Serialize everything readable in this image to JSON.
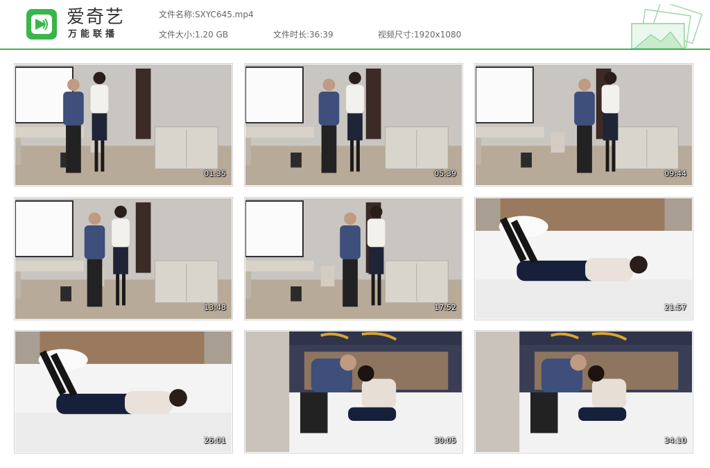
{
  "brand": {
    "name": "爱奇艺",
    "tagline": "万能联播",
    "color": "#3ab54a"
  },
  "file_info": {
    "name_label": "文件名称:",
    "name_value": "SXYC645.mp4",
    "size_label": "文件大小:",
    "size_value": "1.20 GB",
    "duration_label": "文件时长:",
    "duration_value": "36:39",
    "resolution_label": "视频尺寸:",
    "resolution_value": "1920x1080"
  },
  "thumbnails": [
    {
      "timestamp": "01:35",
      "scene": "room"
    },
    {
      "timestamp": "05:39",
      "scene": "room"
    },
    {
      "timestamp": "09:44",
      "scene": "room"
    },
    {
      "timestamp": "13:48",
      "scene": "room"
    },
    {
      "timestamp": "17:52",
      "scene": "room"
    },
    {
      "timestamp": "21:57",
      "scene": "bed"
    },
    {
      "timestamp": "26:01",
      "scene": "bed"
    },
    {
      "timestamp": "30:05",
      "scene": "bed2"
    },
    {
      "timestamp": "34:10",
      "scene": "bed2"
    }
  ]
}
